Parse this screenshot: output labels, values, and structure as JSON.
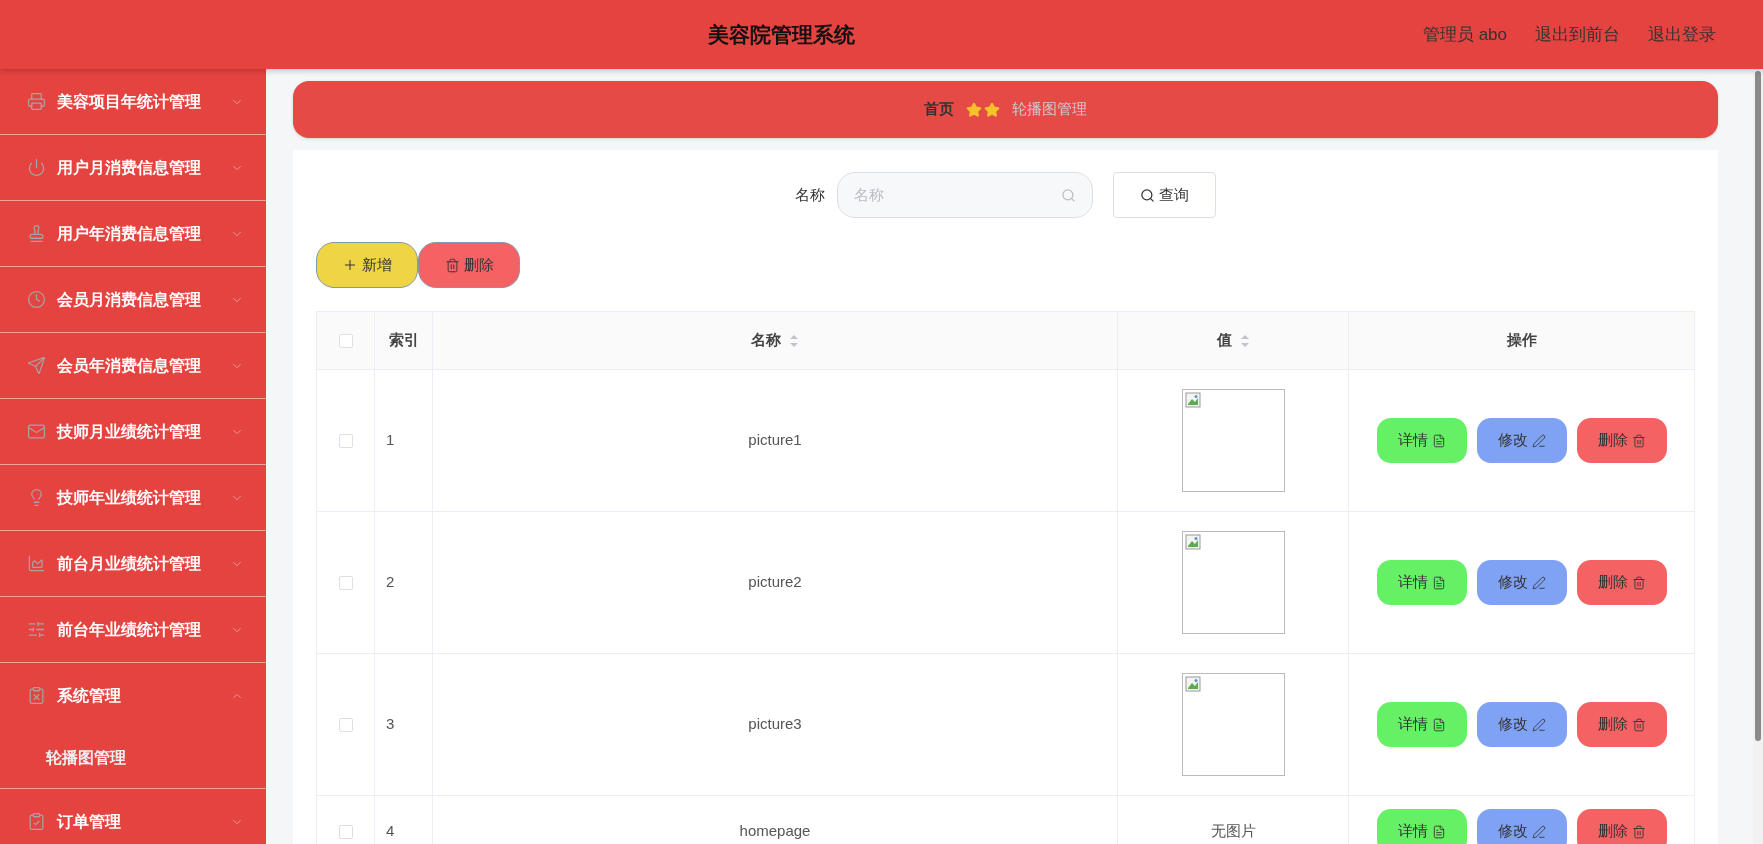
{
  "header": {
    "title": "美容院管理系统",
    "links": [
      "管理员 abo",
      "退出到前台",
      "退出登录"
    ]
  },
  "sidebar": {
    "items": [
      {
        "label": "美容项目年统计管理",
        "expanded": false
      },
      {
        "label": "用户月消费信息管理",
        "expanded": false
      },
      {
        "label": "用户年消费信息管理",
        "expanded": false
      },
      {
        "label": "会员月消费信息管理",
        "expanded": false
      },
      {
        "label": "会员年消费信息管理",
        "expanded": false
      },
      {
        "label": "技师月业绩统计管理",
        "expanded": false
      },
      {
        "label": "技师年业绩统计管理",
        "expanded": false
      },
      {
        "label": "前台月业绩统计管理",
        "expanded": false
      },
      {
        "label": "前台年业绩统计管理",
        "expanded": false
      },
      {
        "label": "系统管理",
        "expanded": true,
        "children": [
          {
            "label": "轮播图管理"
          }
        ]
      },
      {
        "label": "订单管理",
        "expanded": false
      }
    ]
  },
  "breadcrumb": {
    "home": "首页",
    "current": "轮播图管理"
  },
  "search": {
    "label": "名称",
    "placeholder": "名称",
    "button": "查询"
  },
  "actions": [
    {
      "kind": "add",
      "label": "新增"
    },
    {
      "kind": "delete",
      "label": "删除"
    }
  ],
  "table": {
    "all_checked": false,
    "columns": [
      {
        "label": "索引",
        "sortable": false
      },
      {
        "label": "名称",
        "sortable": true
      },
      {
        "label": "值",
        "sortable": true
      },
      {
        "label": "操作",
        "sortable": false
      }
    ],
    "rows": [
      {
        "checked": false,
        "index": "1",
        "name": "picture1",
        "value": {
          "kind": "image"
        },
        "buttons": [
          {
            "kind": "detail",
            "label": "详情"
          },
          {
            "kind": "edit",
            "label": "修改"
          },
          {
            "kind": "delete",
            "label": "删除"
          }
        ]
      },
      {
        "checked": false,
        "index": "2",
        "name": "picture2",
        "value": {
          "kind": "image"
        },
        "buttons": [
          {
            "kind": "detail",
            "label": "详情"
          },
          {
            "kind": "edit",
            "label": "修改"
          },
          {
            "kind": "delete",
            "label": "删除"
          }
        ]
      },
      {
        "checked": false,
        "index": "3",
        "name": "picture3",
        "value": {
          "kind": "image"
        },
        "buttons": [
          {
            "kind": "detail",
            "label": "详情"
          },
          {
            "kind": "edit",
            "label": "修改"
          },
          {
            "kind": "delete",
            "label": "删除"
          }
        ]
      },
      {
        "checked": false,
        "index": "4",
        "name": "homepage",
        "value": {
          "kind": "text",
          "text": "无图片"
        },
        "buttons": [
          {
            "kind": "detail",
            "label": "详情"
          },
          {
            "kind": "edit",
            "label": "修改"
          },
          {
            "kind": "delete",
            "label": "删除"
          }
        ]
      }
    ]
  }
}
